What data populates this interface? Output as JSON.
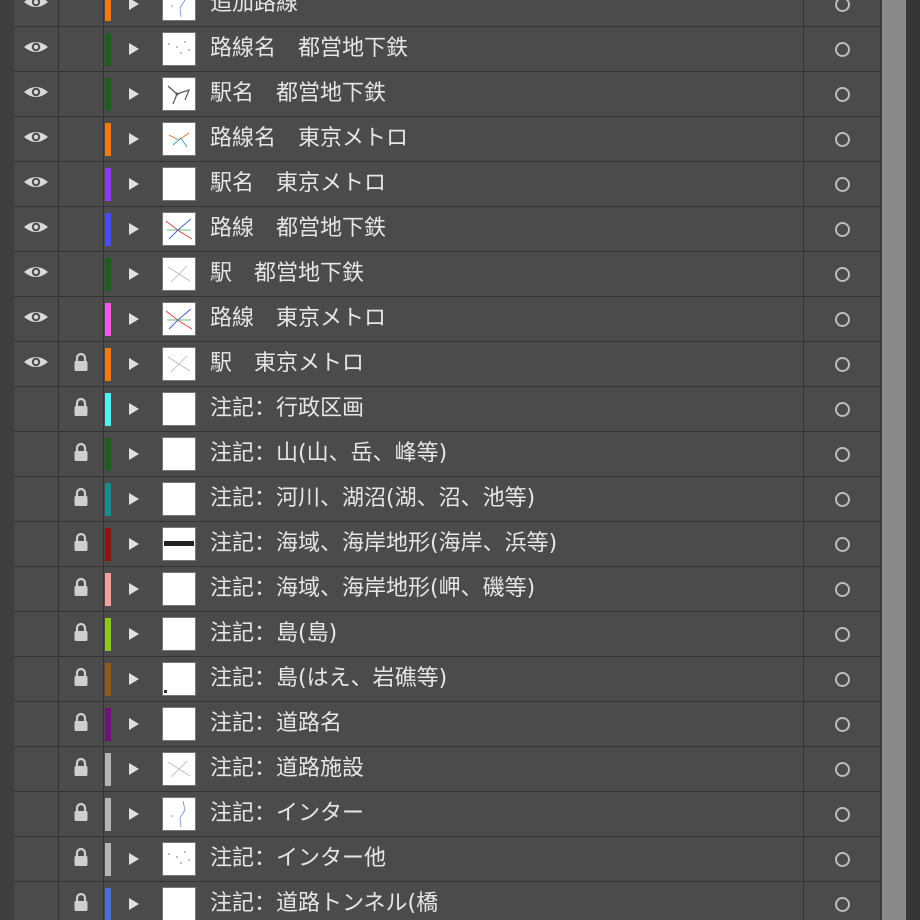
{
  "panel": {
    "layers": [
      {
        "name": "追加路線",
        "visible": true,
        "locked": false,
        "color": "#f07a14",
        "thumb": "map-sparse"
      },
      {
        "name": "路線名　都営地下鉄",
        "visible": true,
        "locked": false,
        "color": "#1f5c1f",
        "thumb": "map-dots"
      },
      {
        "name": "駅名　都営地下鉄",
        "visible": true,
        "locked": false,
        "color": "#1f5c1f",
        "thumb": "map-cluster"
      },
      {
        "name": "路線名　東京メトロ",
        "visible": true,
        "locked": false,
        "color": "#f07a14",
        "thumb": "map-color"
      },
      {
        "name": "駅名　東京メトロ",
        "visible": true,
        "locked": false,
        "color": "#8a3df0",
        "thumb": "blank"
      },
      {
        "name": "路線　都営地下鉄",
        "visible": true,
        "locked": false,
        "color": "#4b4bf0",
        "thumb": "map-lines"
      },
      {
        "name": "駅　都営地下鉄",
        "visible": true,
        "locked": false,
        "color": "#1f5c1f",
        "thumb": "map-faint"
      },
      {
        "name": "路線　東京メトロ",
        "visible": true,
        "locked": false,
        "color": "#f05ae6",
        "thumb": "map-lines"
      },
      {
        "name": "駅　東京メトロ",
        "visible": true,
        "locked": true,
        "color": "#f07a14",
        "thumb": "map-faint"
      },
      {
        "name": "注記：行政区画",
        "visible": false,
        "locked": true,
        "color": "#4ff0f0",
        "thumb": "blank"
      },
      {
        "name": "注記：山(山、岳、峰等)",
        "visible": false,
        "locked": true,
        "color": "#1f5c1f",
        "thumb": "blank"
      },
      {
        "name": "注記：河川、湖沼(湖、沼、池等)",
        "visible": false,
        "locked": true,
        "color": "#178c8c",
        "thumb": "blank"
      },
      {
        "name": "注記：海域、海岸地形(海岸、浜等)",
        "visible": false,
        "locked": true,
        "color": "#8c1414",
        "thumb": "text-strip"
      },
      {
        "name": "注記：海域、海岸地形(岬、磯等)",
        "visible": false,
        "locked": true,
        "color": "#f0a0a0",
        "thumb": "blank"
      },
      {
        "name": "注記：島(島)",
        "visible": false,
        "locked": true,
        "color": "#8cc81e",
        "thumb": "blank"
      },
      {
        "name": "注記：島(はえ、岩礁等)",
        "visible": false,
        "locked": true,
        "color": "#8c5a1e",
        "thumb": "blank-dot"
      },
      {
        "name": "注記：道路名",
        "visible": false,
        "locked": true,
        "color": "#6e1478",
        "thumb": "blank"
      },
      {
        "name": "注記：道路施設",
        "visible": false,
        "locked": true,
        "color": "#b4b4b4",
        "thumb": "map-faint"
      },
      {
        "name": "注記：インター",
        "visible": false,
        "locked": true,
        "color": "#b4b4b4",
        "thumb": "map-sparse"
      },
      {
        "name": "注記：インター他",
        "visible": false,
        "locked": true,
        "color": "#b4b4b4",
        "thumb": "map-dots"
      },
      {
        "name": "注記：道路トンネル(橋",
        "visible": false,
        "locked": true,
        "color": "#4b6ed2",
        "thumb": "blank"
      }
    ],
    "icons": {
      "eye": "eye-icon",
      "lock": "lock-icon",
      "disclosure": "disclosure-triangle-icon",
      "target": "target-circle-icon"
    }
  }
}
